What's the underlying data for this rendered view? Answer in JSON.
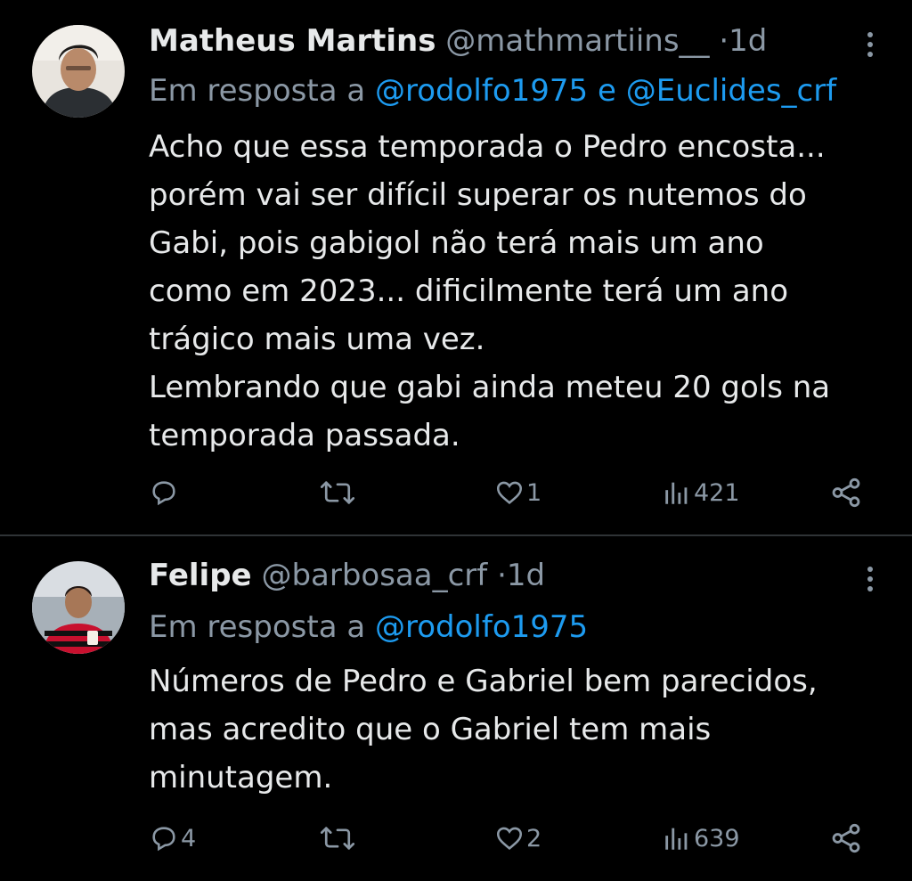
{
  "colors": {
    "background": "#000000",
    "text": "#e7e9ea",
    "secondary": "#8b98a5",
    "mention": "#1d9bf0",
    "divider": "#2f3336"
  },
  "tweets": [
    {
      "name": "Matheus Martins",
      "handle": "@mathmartiins__",
      "dot": "·",
      "time": "1d",
      "reply_prefix": "Em resposta a",
      "reply_mention_1": "@rodolfo1975",
      "reply_joiner": "e",
      "reply_mention_2": "@Euclides_crf",
      "body_lines": [
        "Acho que essa temporada o Pedro encosta...",
        "porém vai ser difícil superar os nutemos do",
        "Gabi, pois gabigol não terá mais um ano",
        "como em 2023... dificilmente terá um ano",
        "trágico mais uma vez.",
        "Lembrando que gabi ainda meteu 20 gols na",
        "temporada passada."
      ],
      "replies": "",
      "retweets": "",
      "likes": "1",
      "views": "421",
      "icons": [
        "reply-icon",
        "retweet-icon",
        "like-icon",
        "views-icon",
        "share-icon"
      ]
    },
    {
      "name": "Felipe",
      "handle": "@barbosaa_crf",
      "dot": "·",
      "time": "1d",
      "reply_prefix": "Em resposta a",
      "reply_mention_1": "@rodolfo1975",
      "body_lines": [
        "Números de Pedro e Gabriel bem parecidos,",
        "mas acredito que o Gabriel tem mais",
        "minutagem."
      ],
      "replies": "4",
      "retweets": "",
      "likes": "2",
      "views": "639",
      "icons": [
        "reply-icon",
        "retweet-icon",
        "like-icon",
        "views-icon",
        "share-icon"
      ]
    }
  ]
}
